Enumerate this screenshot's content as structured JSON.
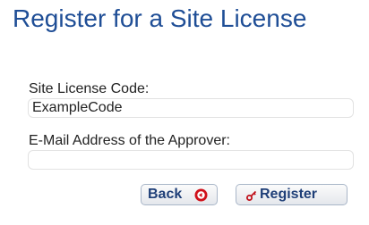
{
  "page": {
    "title": "Register for a Site License"
  },
  "form": {
    "site_license_code": {
      "label": "Site License Code:",
      "value": "ExampleCode",
      "placeholder": ""
    },
    "approver_email": {
      "label": "E-Mail Address of the Approver:",
      "value": "",
      "placeholder": ""
    }
  },
  "buttons": {
    "back_label": "Back",
    "register_label": "Register"
  },
  "icons": {
    "back": "circle-arrow-left-icon",
    "register": "key-icon"
  },
  "colors": {
    "title": "#1f4e96",
    "button_text": "#1f3f78",
    "back_icon": "#d0101a",
    "key_icon": "#c0101a"
  }
}
